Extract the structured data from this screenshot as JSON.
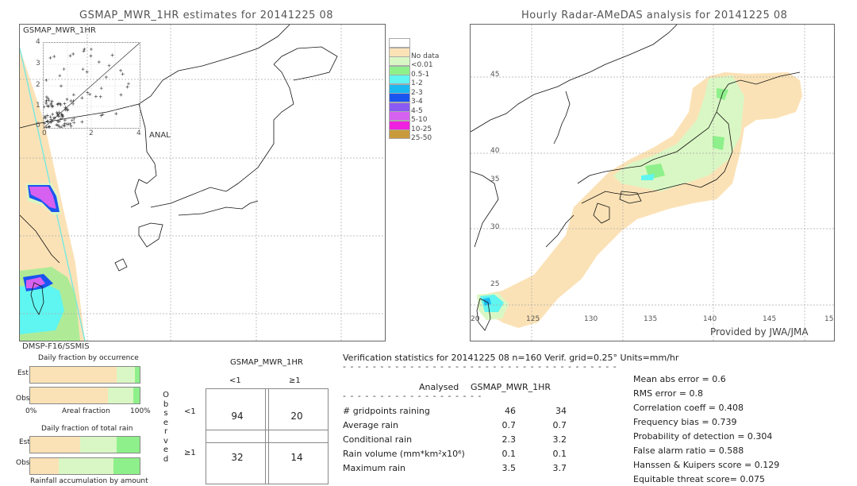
{
  "left_panel": {
    "title": "GSMAP_MWR_1HR estimates for 20141225 08",
    "inset": {
      "label": "GSMAP_MWR_1HR",
      "y_ticks": [
        "4",
        "3",
        "2",
        "1",
        "0"
      ],
      "x_ticks": [
        "0",
        "2",
        "4"
      ],
      "x_label": "ANAL"
    },
    "satellite_label": "DMSP-F16/SSMIS"
  },
  "right_panel": {
    "title": "Hourly Radar-AMeDAS analysis for 20141225 08",
    "lat_ticks": [
      "45",
      "40",
      "35",
      "30",
      "25"
    ],
    "lon_ticks": [
      "20",
      "125",
      "130",
      "135",
      "140",
      "145",
      "15"
    ],
    "credit": "Provided by JWA/JMA"
  },
  "legend": {
    "items": [
      {
        "label": "",
        "color": "#ffffff"
      },
      {
        "label": "No data",
        "color": "#fbe2b6"
      },
      {
        "label": "<0.01",
        "color": "#d9f7c4"
      },
      {
        "label": "0.5-1",
        "color": "#8ef08a"
      },
      {
        "label": "1-2",
        "color": "#5ff5f0"
      },
      {
        "label": "2-3",
        "color": "#1ab9f2"
      },
      {
        "label": "3-4",
        "color": "#1a55f0"
      },
      {
        "label": "4-5",
        "color": "#8a5af2"
      },
      {
        "label": "5-10",
        "color": "#d660f0"
      },
      {
        "label": "10-25",
        "color": "#f020e0"
      },
      {
        "label": "25-50",
        "color": "#c89a3c"
      }
    ]
  },
  "fraction_occurrence": {
    "title": "Daily fraction by occurrence",
    "rows": [
      {
        "label": "Est",
        "segments": [
          0.79,
          0.17,
          0.04
        ]
      },
      {
        "label": "Obs",
        "segments": [
          0.71,
          0.23,
          0.06
        ]
      }
    ],
    "axis_left": "0%",
    "axis_mid": "Areal fraction",
    "axis_right": "100%"
  },
  "fraction_total": {
    "title": "Daily fraction of total rain",
    "rows": [
      {
        "label": "Est",
        "segments": [
          0.46,
          0.33,
          0.21
        ]
      },
      {
        "label": "Obs",
        "segments": [
          0.26,
          0.5,
          0.24
        ]
      }
    ],
    "footer": "Rainfall accumulation by amount"
  },
  "contingency": {
    "header": "GSMAP_MWR_1HR",
    "col_labels": [
      "<1",
      "≥1"
    ],
    "row_labels": [
      "<1",
      "≥1"
    ],
    "side_label": "Observed",
    "cells": [
      [
        "94",
        "20"
      ],
      [
        "32",
        "14"
      ]
    ]
  },
  "verification": {
    "heading": "Verification statistics for 20141225 08   n=160   Verif. grid=0.25°   Units=mm/hr",
    "col_analysed": "Analysed",
    "col_model": "GSMAP_MWR_1HR",
    "rows": [
      {
        "label": "# gridpoints raining",
        "analysed": "46",
        "model": "34"
      },
      {
        "label": "Average rain",
        "analysed": "0.7",
        "model": "0.7"
      },
      {
        "label": "Conditional rain",
        "analysed": "2.3",
        "model": "3.2"
      },
      {
        "label": "Rain volume (mm*km²x10⁶)",
        "analysed": "0.1",
        "model": "0.1"
      },
      {
        "label": "Maximum rain",
        "analysed": "3.5",
        "model": "3.7"
      }
    ],
    "scores": [
      "Mean abs error = 0.6",
      "RMS error = 0.8",
      "Correlation coeff = 0.408",
      "Frequency bias = 0.739",
      "Probability of detection = 0.304",
      "False alarm ratio = 0.588",
      "Hanssen & Kuipers score = 0.129",
      "Equitable threat score= 0.075"
    ]
  },
  "colors": {
    "nodata": "#fbe2b6",
    "light_green": "#d9f7c4",
    "green": "#8ef08a",
    "cyan": "#5ff5f0"
  }
}
